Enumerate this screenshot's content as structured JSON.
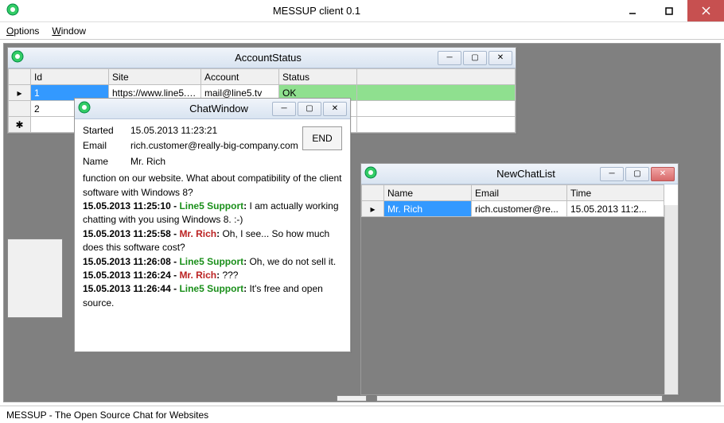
{
  "app": {
    "title": "MESSUP client 0.1",
    "status": "MESSUP - The Open Source Chat for Websites"
  },
  "menu": {
    "options": "Options",
    "window": "Window"
  },
  "accountStatus": {
    "title": "AccountStatus",
    "cols": {
      "id": "Id",
      "site": "Site",
      "account": "Account",
      "status": "Status"
    },
    "rows": [
      {
        "id": "1",
        "site": "https://www.line5.eu...",
        "account": "mail@line5.tv",
        "status": "OK"
      },
      {
        "id": "2",
        "site": "",
        "account": "",
        "status": ""
      }
    ]
  },
  "chat": {
    "title": "ChatWindow",
    "end": "END",
    "labels": {
      "started": "Started",
      "email": "Email",
      "name": "Name"
    },
    "started": "15.05.2013 11:23:21",
    "email": "rich.customer@really-big-company.com",
    "name": "Mr. Rich",
    "line0": "function on our website. What about compatibility of the client software with Windows 8?",
    "msgs": [
      {
        "ts": "15.05.2013 11:25:10",
        "who": "Line5 Support",
        "role": "support",
        "text": " I am actually working chatting with you using Windows 8. :-)"
      },
      {
        "ts": "15.05.2013 11:25:58",
        "who": "Mr. Rich",
        "role": "cust",
        "text": " Oh, I see... So how much does this software cost?"
      },
      {
        "ts": "15.05.2013 11:26:08",
        "who": "Line5 Support",
        "role": "support",
        "text": " Oh, we do not sell it."
      },
      {
        "ts": "15.05.2013 11:26:24",
        "who": "Mr. Rich",
        "role": "cust",
        "text": " ???"
      },
      {
        "ts": "15.05.2013 11:26:44",
        "who": "Line5 Support",
        "role": "support",
        "text": " It's free and open source."
      }
    ]
  },
  "newchat": {
    "title": "NewChatList",
    "cols": {
      "name": "Name",
      "email": "Email",
      "time": "Time"
    },
    "rows": [
      {
        "name": "Mr. Rich",
        "email": "rich.customer@re...",
        "time": "15.05.2013 11:2..."
      }
    ]
  }
}
